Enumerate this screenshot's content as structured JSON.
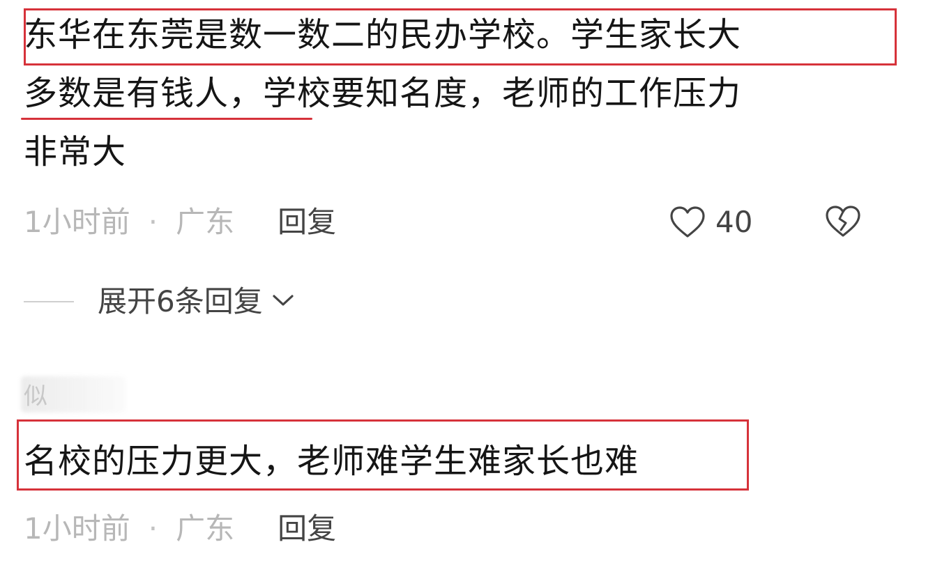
{
  "comment1": {
    "lines": [
      "东华在东莞是数一数二的民办学校。学生家长大",
      "多数是有钱人，学校要知名度，老师的工作压力",
      "非常大"
    ],
    "time": "1小时前",
    "separator": "·",
    "location": "广东",
    "reply_label": "回复",
    "like_count": "40",
    "icons": {
      "like": "heart-outline-icon",
      "dislike": "broken-heart-icon"
    }
  },
  "expand": {
    "label": "展开6条回复",
    "icon": "chevron-down-icon"
  },
  "comment2": {
    "username_partial": "似",
    "text": "名校的压力更大，老师难学生难家长也难",
    "time": "1小时前",
    "separator": "·",
    "location": "广东",
    "reply_label": "回复"
  },
  "colors": {
    "highlight_red": "#d6323a",
    "meta_gray": "#b7b7b7",
    "text_dark": "#151515"
  }
}
